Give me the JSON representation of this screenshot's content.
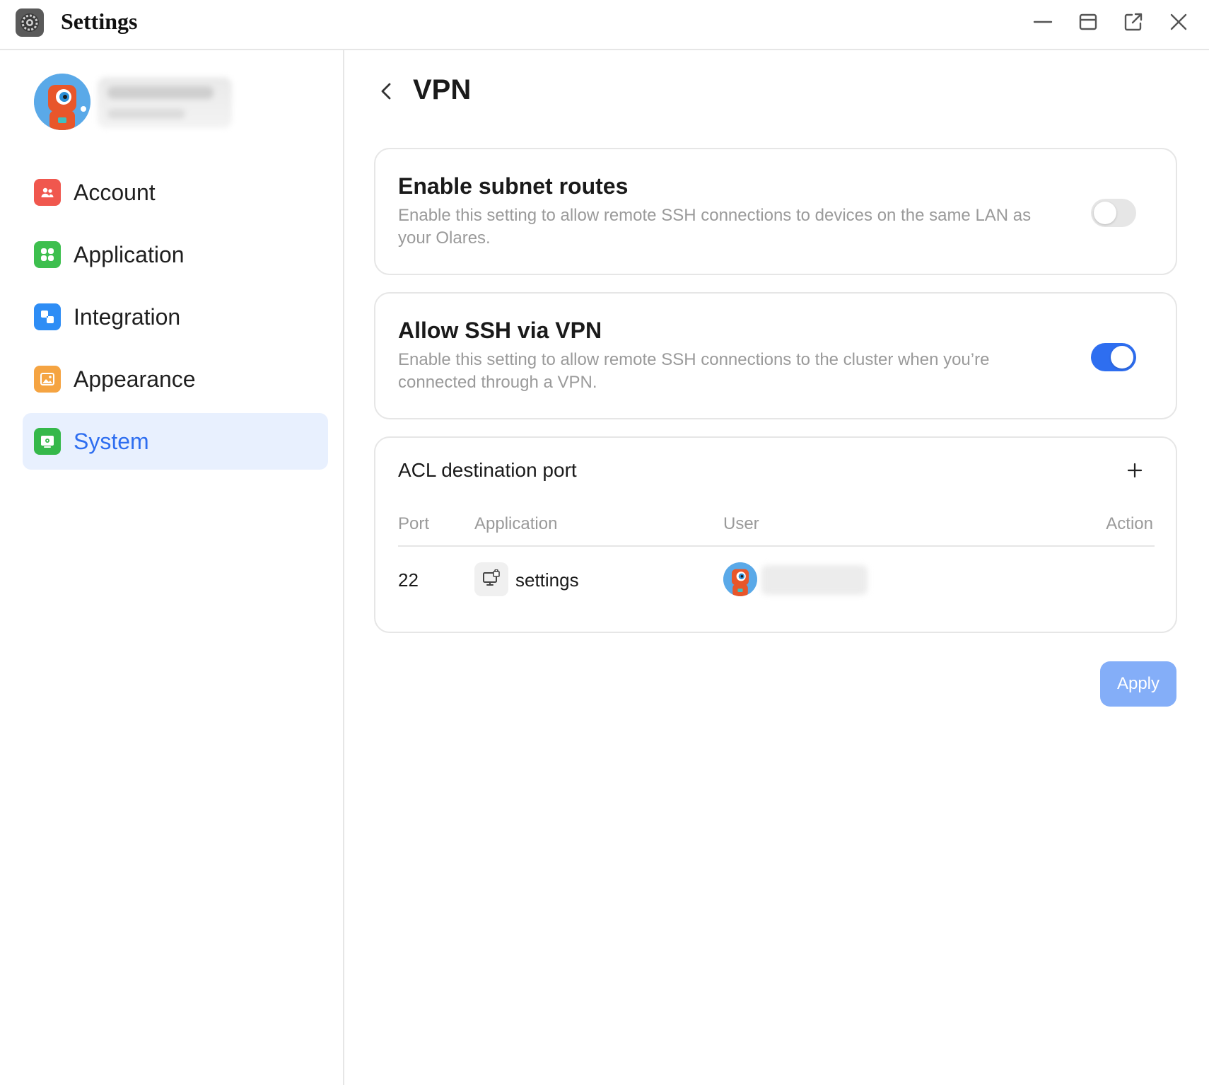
{
  "window": {
    "title": "Settings",
    "icon": "gear-icon",
    "controls": [
      "minimize-icon",
      "maximize-icon",
      "open-external-icon",
      "close-icon"
    ]
  },
  "sidebar": {
    "items": [
      {
        "label": "Account",
        "icon": "account-icon",
        "color": "#f0574e",
        "active": false
      },
      {
        "label": "Application",
        "icon": "application-icon",
        "color": "#3dbf4e",
        "active": false
      },
      {
        "label": "Integration",
        "icon": "integration-icon",
        "color": "#2e8df5",
        "active": false
      },
      {
        "label": "Appearance",
        "icon": "appearance-icon",
        "color": "#f5a442",
        "active": false
      },
      {
        "label": "System",
        "icon": "system-icon",
        "color": "#35b84a",
        "active": true
      }
    ]
  },
  "main": {
    "title": "VPN",
    "subnet": {
      "title": "Enable subnet routes",
      "description": "Enable this setting to allow remote SSH connections to devices on the same LAN as your Olares.",
      "enabled": false
    },
    "ssh": {
      "title": "Allow SSH via VPN",
      "description": "Enable this setting to allow remote SSH connections to the cluster when you’re connected through a VPN.",
      "enabled": true
    },
    "acl": {
      "title": "ACL destination port",
      "columns": {
        "port": "Port",
        "application": "Application",
        "user": "User",
        "action": "Action"
      },
      "rows": [
        {
          "port": "22",
          "application": "settings",
          "app_icon": "monitor-lock-icon"
        }
      ]
    },
    "apply_label": "Apply"
  },
  "colors": {
    "accent": "#2e6ef0",
    "active_bg": "#e8f0fe",
    "apply_bg": "#84aef8"
  }
}
